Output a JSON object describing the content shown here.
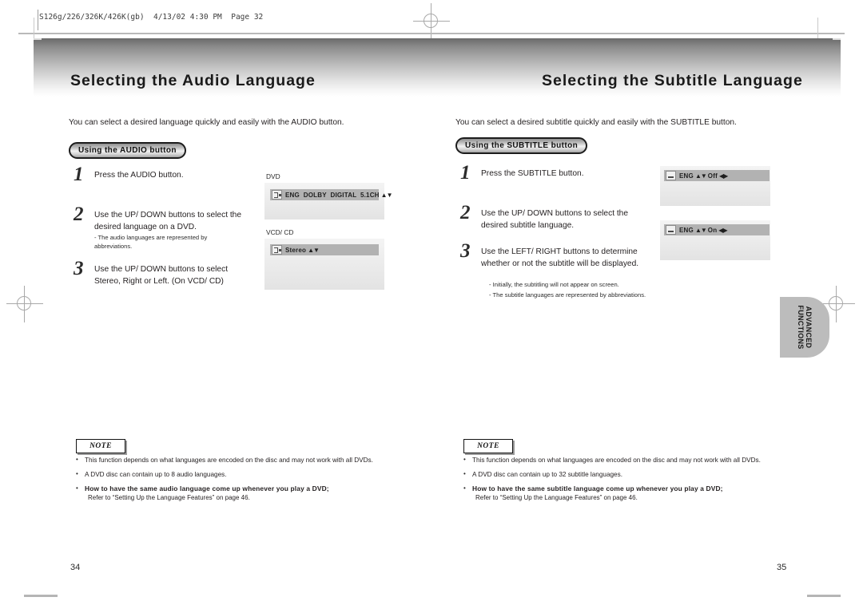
{
  "slug": "S126g/226/326K/426K(gb)  4/13/02 4:30 PM  Page 32",
  "side_tab": {
    "line1": "ADVANCED",
    "line2": "FUNCTIONS"
  },
  "left_page": {
    "title": "Selecting the Audio Language",
    "intro": "You can select a desired language quickly and easily with the AUDIO button.",
    "pill": "Using the AUDIO button",
    "page_number": "34",
    "steps": [
      {
        "num": "1",
        "lines": [
          "Press the AUDIO button."
        ],
        "subs": []
      },
      {
        "num": "2",
        "lines": [
          "Use the UP/ DOWN buttons to select the",
          "desired language on a DVD."
        ],
        "subs": [
          "- The audio languages are represented by",
          "  abbreviations."
        ]
      },
      {
        "num": "3",
        "lines": [
          "Use the UP/ DOWN buttons to select",
          "Stereo, Right or Left. (On VCD/ CD)"
        ],
        "subs": []
      }
    ],
    "screens": [
      {
        "label": "DVD",
        "icon": "audio-mode-icon",
        "text_before": "ENG  DOLBY  DIGITAL  5.1CH",
        "arrows": "▲▼"
      },
      {
        "label": "VCD/ CD",
        "icon": "audio-mode-icon",
        "text_before": "Stereo",
        "arrows": "▲▼"
      }
    ],
    "note": {
      "heading": "NOTE",
      "items": [
        {
          "text": "This function depends on what languages are encoded on the disc and may not work with all DVDs.",
          "bold": false
        },
        {
          "text": "A DVD disc can contain up to 8 audio languages.",
          "bold": false
        },
        {
          "text": "How to have the same audio language come up whenever you play  a DVD;",
          "bold": true,
          "ref": "Refer to “Setting Up the Language Features” on page 46."
        }
      ]
    }
  },
  "right_page": {
    "title": "Selecting the Subtitle Language",
    "intro": "You can select a desired subtitle quickly and easily with the SUBTITLE button.",
    "pill": "Using the SUBTITLE button",
    "page_number": "35",
    "steps": [
      {
        "num": "1",
        "lines": [
          "Press the SUBTITLE button."
        ],
        "subs": []
      },
      {
        "num": "2",
        "lines": [
          "Use the UP/ DOWN buttons to select the",
          "desired subtitle language."
        ],
        "subs": []
      },
      {
        "num": "3",
        "lines": [
          "Use the LEFT/ RIGHT buttons to determine",
          "whether or not the subtitle will be displayed."
        ],
        "subs": []
      }
    ],
    "inline_notes": [
      "- Initially, the subtitling will not appear on screen.",
      "- The subtitle languages are represented by abbreviations."
    ],
    "screens": [
      {
        "icon": "subtitle-icon",
        "lang": "ENG",
        "arrows_ud": "▲▼",
        "state": "Off",
        "arrows_lr": "◀▶"
      },
      {
        "icon": "subtitle-icon",
        "lang": "ENG",
        "arrows_ud": "▲▼",
        "state": "On",
        "arrows_lr": "◀▶"
      }
    ],
    "note": {
      "heading": "NOTE",
      "items": [
        {
          "text": "This function depends on what languages are encoded on the disc and may not work with all DVDs.",
          "bold": false
        },
        {
          "text": "A DVD disc can contain up to 32 subtitle languages.",
          "bold": false
        },
        {
          "text": "How to have the same subtitle language come up whenever you play  a DVD;",
          "bold": true,
          "ref": "Refer to “Setting Up the Language Features” on page 46."
        }
      ]
    }
  },
  "bullet_glyph": "•"
}
